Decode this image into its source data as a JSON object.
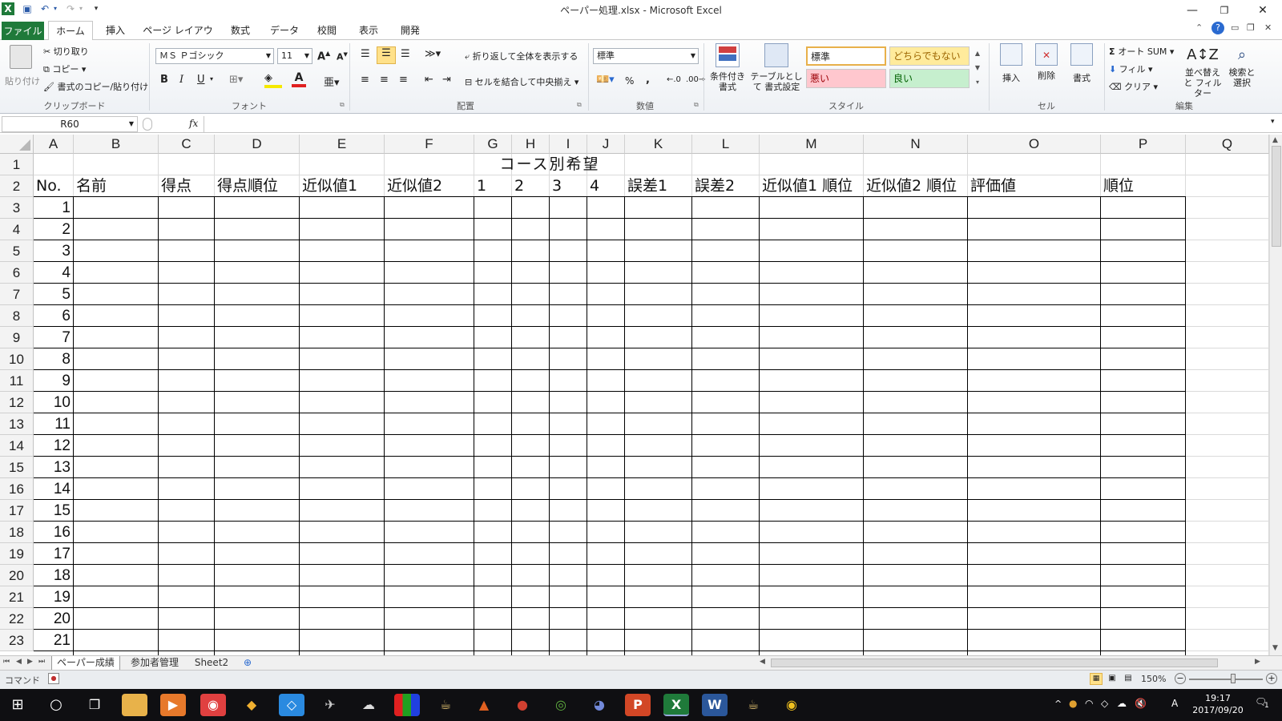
{
  "titlebar": {
    "title": "ペーパー処理.xlsx - Microsoft Excel",
    "qat_excel_icon": "excel-icon",
    "qat_save_icon": "save-icon",
    "qat_undo_icon": "undo-icon",
    "qat_redo_icon": "redo-icon"
  },
  "tabs": {
    "file": "ファイル",
    "home": "ホーム",
    "insert": "挿入",
    "page_layout": "ページ レイアウト",
    "formulas": "数式",
    "data": "データ",
    "review": "校閲",
    "view": "表示",
    "developer": "開発"
  },
  "ribbon": {
    "clipboard": {
      "paste": "貼り付け",
      "cut": "切り取り",
      "copy": "コピー",
      "format_painter": "書式のコピー/貼り付け",
      "label": "クリップボード"
    },
    "font": {
      "name": "ＭＳ Ｐゴシック",
      "size": "11",
      "bold": "B",
      "italic": "I",
      "underline": "U",
      "label": "フォント",
      "font_color": "#e02020",
      "fill_color": "#f5e900"
    },
    "alignment": {
      "wrap": "折り返して全体を表示する",
      "merge": "セルを結合して中央揃え",
      "label": "配置"
    },
    "number": {
      "format": "標準",
      "percent": "%",
      "comma": ",",
      "label": "数値"
    },
    "styles": {
      "conditional": "条件付き 書式",
      "table": "テーブルとして 書式設定",
      "normal": "標準",
      "neutral": "どちらでもない",
      "bad": "悪い",
      "good": "良い",
      "label": "スタイル"
    },
    "cells": {
      "insert": "挿入",
      "delete": "削除",
      "format": "書式",
      "label": "セル"
    },
    "editing": {
      "autosum": "オート SUM",
      "fill": "フィル",
      "clear": "クリア",
      "sort": "並べ替えと フィルター",
      "find": "検索と 選択",
      "label": "編集"
    }
  },
  "formula_bar": {
    "name_box": "R60",
    "fx": "fx",
    "value": ""
  },
  "grid": {
    "columns": [
      "A",
      "B",
      "C",
      "D",
      "E",
      "F",
      "G",
      "H",
      "I",
      "J",
      "K",
      "L",
      "M",
      "N",
      "O",
      "P",
      "Q"
    ],
    "row_numbers": [
      "1",
      "2",
      "3",
      "4",
      "5",
      "6",
      "7",
      "8",
      "9",
      "10",
      "11",
      "12",
      "13",
      "14",
      "15",
      "16",
      "17",
      "18",
      "19",
      "20",
      "21",
      "22",
      "23"
    ],
    "title_cell": "コース別希望",
    "headers": [
      "No.",
      "名前",
      "得点",
      "得点順位",
      "近似値1",
      "近似値2",
      "1",
      "2",
      "3",
      "4",
      "誤差1",
      "誤差2",
      "近似値1 順位",
      "近似値2 順位",
      "評価値",
      "順位"
    ],
    "numbers": [
      "1",
      "2",
      "3",
      "4",
      "5",
      "6",
      "7",
      "8",
      "9",
      "10",
      "11",
      "12",
      "13",
      "14",
      "15",
      "16",
      "17",
      "18",
      "19",
      "20",
      "21"
    ]
  },
  "sheets": {
    "tabs": [
      "ペーパー成績",
      "参加者管理",
      "Sheet2"
    ]
  },
  "status": {
    "mode": "コマンド",
    "zoom": "150%"
  },
  "taskbar": {
    "time": "19:17",
    "date": "2017/09/20",
    "ime": "A",
    "notifications": "1"
  }
}
